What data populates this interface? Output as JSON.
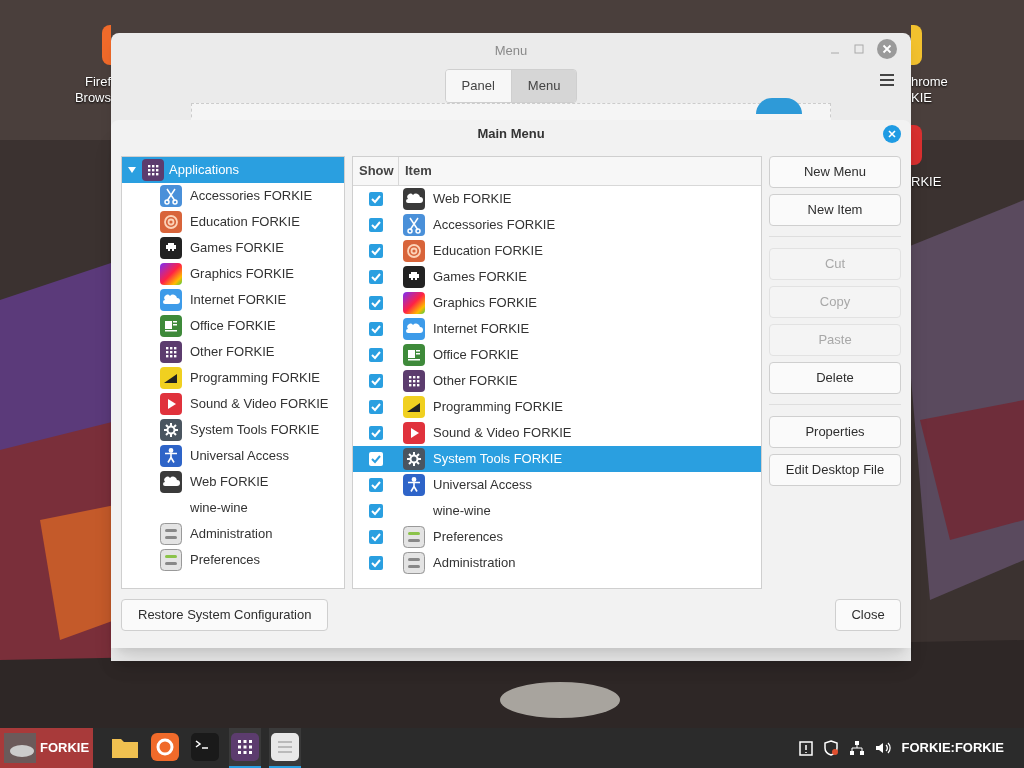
{
  "desktop": {
    "icons": [
      {
        "kind": "orange",
        "lines": [
          "Firef",
          "Brows"
        ]
      },
      {
        "kind": "yellow",
        "lines": [
          "hrome",
          "KIE"
        ]
      },
      {
        "kind": "red",
        "lines": [
          "RKIE"
        ]
      }
    ]
  },
  "back_window": {
    "title": "Menu",
    "tabs": [
      {
        "label": "Panel",
        "selected": false
      },
      {
        "label": "Menu",
        "selected": true
      }
    ],
    "toggle": {
      "on": true
    }
  },
  "dialog": {
    "title": "Main Menu",
    "tree": {
      "label": "Applications",
      "kind": "other",
      "expanded": true,
      "selected": true,
      "children": [
        {
          "label": "Accessories FORKIE",
          "kind": "accessories"
        },
        {
          "label": "Education FORKIE",
          "kind": "education"
        },
        {
          "label": "Games FORKIE",
          "kind": "games"
        },
        {
          "label": "Graphics FORKIE",
          "kind": "graphics"
        },
        {
          "label": "Internet FORKIE",
          "kind": "internet"
        },
        {
          "label": "Office FORKIE",
          "kind": "office"
        },
        {
          "label": "Other FORKIE",
          "kind": "other"
        },
        {
          "label": "Programming FORKIE",
          "kind": "programming"
        },
        {
          "label": "Sound & Video FORKIE",
          "kind": "sound"
        },
        {
          "label": "System Tools FORKIE",
          "kind": "system"
        },
        {
          "label": "Universal Access",
          "kind": "access"
        },
        {
          "label": "Web FORKIE",
          "kind": "web"
        },
        {
          "label": "wine-wine",
          "kind": "plain"
        },
        {
          "label": "Administration",
          "kind": "admin"
        },
        {
          "label": "Preferences",
          "kind": "prefs"
        }
      ]
    },
    "columns": [
      "Show",
      "Item"
    ],
    "rows": [
      {
        "label": "Web FORKIE",
        "kind": "web",
        "checked": true,
        "selected": false
      },
      {
        "label": "Accessories FORKIE",
        "kind": "accessories",
        "checked": true,
        "selected": false
      },
      {
        "label": "Education FORKIE",
        "kind": "education",
        "checked": true,
        "selected": false
      },
      {
        "label": "Games FORKIE",
        "kind": "games",
        "checked": true,
        "selected": false
      },
      {
        "label": "Graphics FORKIE",
        "kind": "graphics",
        "checked": true,
        "selected": false
      },
      {
        "label": "Internet FORKIE",
        "kind": "internet",
        "checked": true,
        "selected": false
      },
      {
        "label": "Office FORKIE",
        "kind": "office",
        "checked": true,
        "selected": false
      },
      {
        "label": "Other FORKIE",
        "kind": "other",
        "checked": true,
        "selected": false
      },
      {
        "label": "Programming FORKIE",
        "kind": "programming",
        "checked": true,
        "selected": false
      },
      {
        "label": "Sound & Video FORKIE",
        "kind": "sound",
        "checked": true,
        "selected": false
      },
      {
        "label": "System Tools FORKIE",
        "kind": "system",
        "checked": true,
        "selected": true
      },
      {
        "label": "Universal Access",
        "kind": "access",
        "checked": true,
        "selected": false
      },
      {
        "label": "wine-wine",
        "kind": "plain",
        "checked": true,
        "selected": false
      },
      {
        "label": "Preferences",
        "kind": "prefs",
        "checked": true,
        "selected": false
      },
      {
        "label": "Administration",
        "kind": "admin",
        "checked": true,
        "selected": false
      }
    ],
    "button_groups": [
      [
        {
          "label": "New Menu",
          "disabled": false
        },
        {
          "label": "New Item",
          "disabled": false
        }
      ],
      [
        {
          "label": "Cut",
          "disabled": true
        },
        {
          "label": "Copy",
          "disabled": true
        },
        {
          "label": "Paste",
          "disabled": true
        },
        {
          "label": "Delete",
          "disabled": false
        }
      ],
      [
        {
          "label": "Properties",
          "disabled": false
        },
        {
          "label": "Edit Desktop File",
          "disabled": false
        }
      ]
    ],
    "restore_button": "Restore System Configuration",
    "close_button": "Close"
  },
  "taskbar": {
    "start_label": "FORKIE",
    "apps": [
      {
        "kind": "folder",
        "active": false
      },
      {
        "kind": "firefox",
        "active": false
      },
      {
        "kind": "terminal",
        "active": false
      },
      {
        "kind": "apps",
        "active": true
      },
      {
        "kind": "editor",
        "active": true
      }
    ],
    "user": "FORKIE:FORKIE"
  }
}
